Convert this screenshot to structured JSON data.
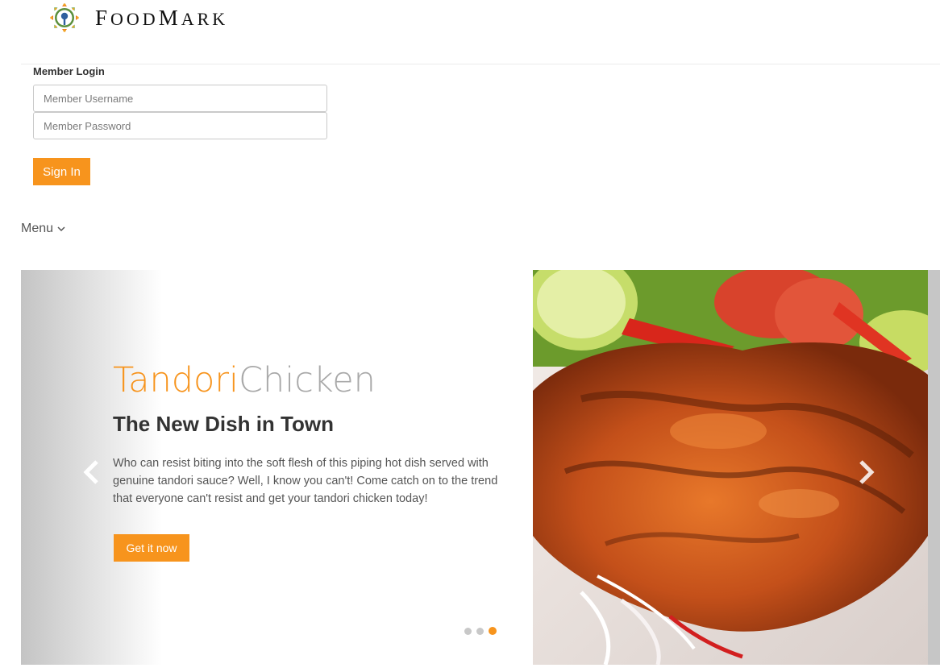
{
  "brand": {
    "name_first": "F",
    "name_rest": "OOD",
    "name_second": "M",
    "name_rest2": "ARK",
    "accent_color": "#f7941d",
    "logo_icon": "foodmark-logo-icon"
  },
  "login": {
    "title": "Member Login",
    "username_placeholder": "Member Username",
    "password_placeholder": "Member Password",
    "signin_label": "Sign In"
  },
  "nav": {
    "menu_label": "Menu",
    "menu_icon": "chevron-down-icon"
  },
  "slider": {
    "headline_part1": "Tandori",
    "headline_part2": "Chicken",
    "subheading": "The New Dish in Town",
    "description": "Who can resist biting into the soft flesh of this piping hot dish served with genuine tandori sauce? Well, I know you can't! Come catch on to the trend that everyone can't resist and get your tandori chicken today!",
    "cta_label": "Get it now",
    "prev_icon": "chevron-left-icon",
    "next_icon": "chevron-right-icon",
    "slide_count": 3,
    "active_slide": 3
  }
}
